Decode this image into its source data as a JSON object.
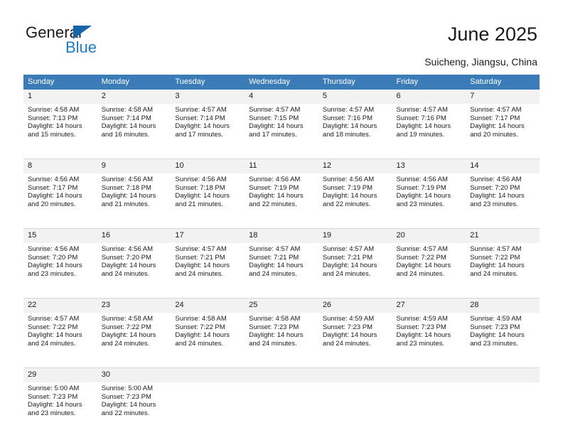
{
  "logo": {
    "text_top": "General",
    "text_bottom": "Blue",
    "triangle_color": "#1565a8",
    "blue_color": "#1f7cc4"
  },
  "header": {
    "title": "June 2025",
    "subtitle": "Suicheng, Jiangsu, China",
    "header_bg_color": "#3b7cb8",
    "daynum_bg_color": "#f2f2f2"
  },
  "calendar": {
    "weekday_headers": [
      "Sunday",
      "Monday",
      "Tuesday",
      "Wednesday",
      "Thursday",
      "Friday",
      "Saturday"
    ],
    "weeks": [
      [
        {
          "day": "1",
          "sunrise": "Sunrise: 4:58 AM",
          "sunset": "Sunset: 7:13 PM",
          "daylight_1": "Daylight: 14 hours",
          "daylight_2": "and 15 minutes."
        },
        {
          "day": "2",
          "sunrise": "Sunrise: 4:58 AM",
          "sunset": "Sunset: 7:14 PM",
          "daylight_1": "Daylight: 14 hours",
          "daylight_2": "and 16 minutes."
        },
        {
          "day": "3",
          "sunrise": "Sunrise: 4:57 AM",
          "sunset": "Sunset: 7:14 PM",
          "daylight_1": "Daylight: 14 hours",
          "daylight_2": "and 17 minutes."
        },
        {
          "day": "4",
          "sunrise": "Sunrise: 4:57 AM",
          "sunset": "Sunset: 7:15 PM",
          "daylight_1": "Daylight: 14 hours",
          "daylight_2": "and 17 minutes."
        },
        {
          "day": "5",
          "sunrise": "Sunrise: 4:57 AM",
          "sunset": "Sunset: 7:16 PM",
          "daylight_1": "Daylight: 14 hours",
          "daylight_2": "and 18 minutes."
        },
        {
          "day": "6",
          "sunrise": "Sunrise: 4:57 AM",
          "sunset": "Sunset: 7:16 PM",
          "daylight_1": "Daylight: 14 hours",
          "daylight_2": "and 19 minutes."
        },
        {
          "day": "7",
          "sunrise": "Sunrise: 4:57 AM",
          "sunset": "Sunset: 7:17 PM",
          "daylight_1": "Daylight: 14 hours",
          "daylight_2": "and 20 minutes."
        }
      ],
      [
        {
          "day": "8",
          "sunrise": "Sunrise: 4:56 AM",
          "sunset": "Sunset: 7:17 PM",
          "daylight_1": "Daylight: 14 hours",
          "daylight_2": "and 20 minutes."
        },
        {
          "day": "9",
          "sunrise": "Sunrise: 4:56 AM",
          "sunset": "Sunset: 7:18 PM",
          "daylight_1": "Daylight: 14 hours",
          "daylight_2": "and 21 minutes."
        },
        {
          "day": "10",
          "sunrise": "Sunrise: 4:56 AM",
          "sunset": "Sunset: 7:18 PM",
          "daylight_1": "Daylight: 14 hours",
          "daylight_2": "and 21 minutes."
        },
        {
          "day": "11",
          "sunrise": "Sunrise: 4:56 AM",
          "sunset": "Sunset: 7:19 PM",
          "daylight_1": "Daylight: 14 hours",
          "daylight_2": "and 22 minutes."
        },
        {
          "day": "12",
          "sunrise": "Sunrise: 4:56 AM",
          "sunset": "Sunset: 7:19 PM",
          "daylight_1": "Daylight: 14 hours",
          "daylight_2": "and 22 minutes."
        },
        {
          "day": "13",
          "sunrise": "Sunrise: 4:56 AM",
          "sunset": "Sunset: 7:19 PM",
          "daylight_1": "Daylight: 14 hours",
          "daylight_2": "and 23 minutes."
        },
        {
          "day": "14",
          "sunrise": "Sunrise: 4:56 AM",
          "sunset": "Sunset: 7:20 PM",
          "daylight_1": "Daylight: 14 hours",
          "daylight_2": "and 23 minutes."
        }
      ],
      [
        {
          "day": "15",
          "sunrise": "Sunrise: 4:56 AM",
          "sunset": "Sunset: 7:20 PM",
          "daylight_1": "Daylight: 14 hours",
          "daylight_2": "and 23 minutes."
        },
        {
          "day": "16",
          "sunrise": "Sunrise: 4:56 AM",
          "sunset": "Sunset: 7:20 PM",
          "daylight_1": "Daylight: 14 hours",
          "daylight_2": "and 24 minutes."
        },
        {
          "day": "17",
          "sunrise": "Sunrise: 4:57 AM",
          "sunset": "Sunset: 7:21 PM",
          "daylight_1": "Daylight: 14 hours",
          "daylight_2": "and 24 minutes."
        },
        {
          "day": "18",
          "sunrise": "Sunrise: 4:57 AM",
          "sunset": "Sunset: 7:21 PM",
          "daylight_1": "Daylight: 14 hours",
          "daylight_2": "and 24 minutes."
        },
        {
          "day": "19",
          "sunrise": "Sunrise: 4:57 AM",
          "sunset": "Sunset: 7:21 PM",
          "daylight_1": "Daylight: 14 hours",
          "daylight_2": "and 24 minutes."
        },
        {
          "day": "20",
          "sunrise": "Sunrise: 4:57 AM",
          "sunset": "Sunset: 7:22 PM",
          "daylight_1": "Daylight: 14 hours",
          "daylight_2": "and 24 minutes."
        },
        {
          "day": "21",
          "sunrise": "Sunrise: 4:57 AM",
          "sunset": "Sunset: 7:22 PM",
          "daylight_1": "Daylight: 14 hours",
          "daylight_2": "and 24 minutes."
        }
      ],
      [
        {
          "day": "22",
          "sunrise": "Sunrise: 4:57 AM",
          "sunset": "Sunset: 7:22 PM",
          "daylight_1": "Daylight: 14 hours",
          "daylight_2": "and 24 minutes."
        },
        {
          "day": "23",
          "sunrise": "Sunrise: 4:58 AM",
          "sunset": "Sunset: 7:22 PM",
          "daylight_1": "Daylight: 14 hours",
          "daylight_2": "and 24 minutes."
        },
        {
          "day": "24",
          "sunrise": "Sunrise: 4:58 AM",
          "sunset": "Sunset: 7:22 PM",
          "daylight_1": "Daylight: 14 hours",
          "daylight_2": "and 24 minutes."
        },
        {
          "day": "25",
          "sunrise": "Sunrise: 4:58 AM",
          "sunset": "Sunset: 7:23 PM",
          "daylight_1": "Daylight: 14 hours",
          "daylight_2": "and 24 minutes."
        },
        {
          "day": "26",
          "sunrise": "Sunrise: 4:59 AM",
          "sunset": "Sunset: 7:23 PM",
          "daylight_1": "Daylight: 14 hours",
          "daylight_2": "and 24 minutes."
        },
        {
          "day": "27",
          "sunrise": "Sunrise: 4:59 AM",
          "sunset": "Sunset: 7:23 PM",
          "daylight_1": "Daylight: 14 hours",
          "daylight_2": "and 23 minutes."
        },
        {
          "day": "28",
          "sunrise": "Sunrise: 4:59 AM",
          "sunset": "Sunset: 7:23 PM",
          "daylight_1": "Daylight: 14 hours",
          "daylight_2": "and 23 minutes."
        }
      ],
      [
        {
          "day": "29",
          "sunrise": "Sunrise: 5:00 AM",
          "sunset": "Sunset: 7:23 PM",
          "daylight_1": "Daylight: 14 hours",
          "daylight_2": "and 23 minutes."
        },
        {
          "day": "30",
          "sunrise": "Sunrise: 5:00 AM",
          "sunset": "Sunset: 7:23 PM",
          "daylight_1": "Daylight: 14 hours",
          "daylight_2": "and 22 minutes."
        },
        {
          "day": "",
          "sunrise": "",
          "sunset": "",
          "daylight_1": "",
          "daylight_2": ""
        },
        {
          "day": "",
          "sunrise": "",
          "sunset": "",
          "daylight_1": "",
          "daylight_2": ""
        },
        {
          "day": "",
          "sunrise": "",
          "sunset": "",
          "daylight_1": "",
          "daylight_2": ""
        },
        {
          "day": "",
          "sunrise": "",
          "sunset": "",
          "daylight_1": "",
          "daylight_2": ""
        },
        {
          "day": "",
          "sunrise": "",
          "sunset": "",
          "daylight_1": "",
          "daylight_2": ""
        }
      ]
    ]
  }
}
